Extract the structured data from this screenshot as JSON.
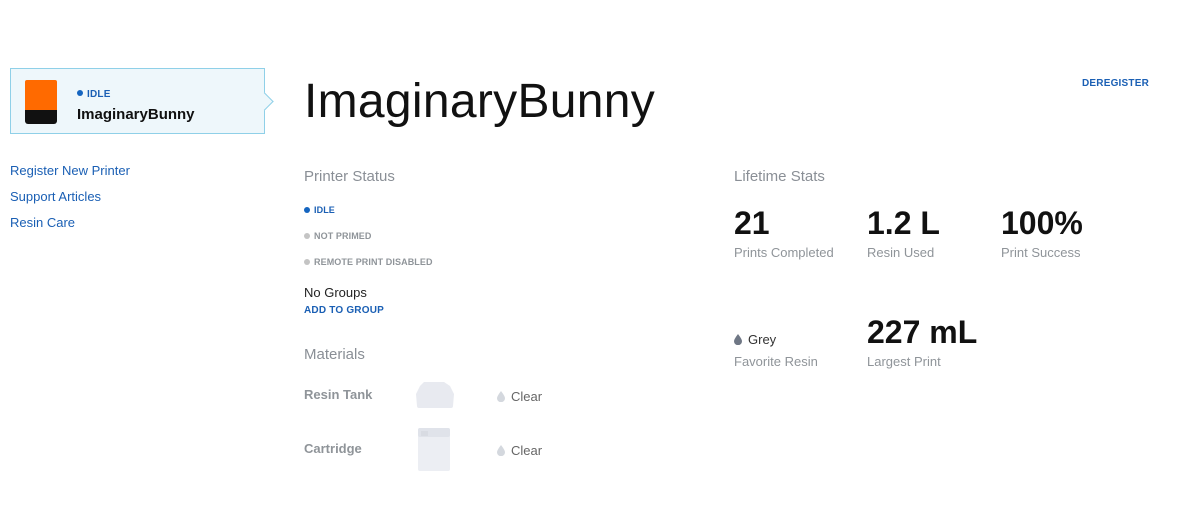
{
  "sidebar": {
    "printer": {
      "status": "IDLE",
      "name": "ImaginaryBunny"
    },
    "links": [
      "Register New Printer",
      "Support Articles",
      "Resin Care"
    ]
  },
  "header": {
    "title": "ImaginaryBunny",
    "deregister": "DEREGISTER"
  },
  "printer_status": {
    "heading": "Printer Status",
    "items": [
      {
        "label": "IDLE",
        "active": true
      },
      {
        "label": "NOT PRIMED",
        "active": false
      },
      {
        "label": "REMOTE PRINT DISABLED",
        "active": false
      }
    ],
    "groups_text": "No Groups",
    "add_group": "ADD TO GROUP"
  },
  "materials": {
    "heading": "Materials",
    "rows": [
      {
        "label": "Resin Tank",
        "icon": "resin-tank-icon",
        "value": "Clear"
      },
      {
        "label": "Cartridge",
        "icon": "cartridge-icon",
        "value": "Clear"
      }
    ]
  },
  "lifetime_stats": {
    "heading": "Lifetime Stats",
    "prints_completed": {
      "value": "21",
      "label": "Prints Completed"
    },
    "resin_used": {
      "value": "1.2 L",
      "label": "Resin Used"
    },
    "print_success": {
      "value": "100%",
      "label": "Print Success"
    },
    "favorite_resin": {
      "value": "Grey",
      "label": "Favorite Resin"
    },
    "largest_print": {
      "value": "227 mL",
      "label": "Largest Print"
    }
  },
  "colors": {
    "accent": "#1a5fb4",
    "printer_orange": "#ff6a00",
    "card_bg": "#eef7fb",
    "card_border": "#8fd0e8"
  }
}
